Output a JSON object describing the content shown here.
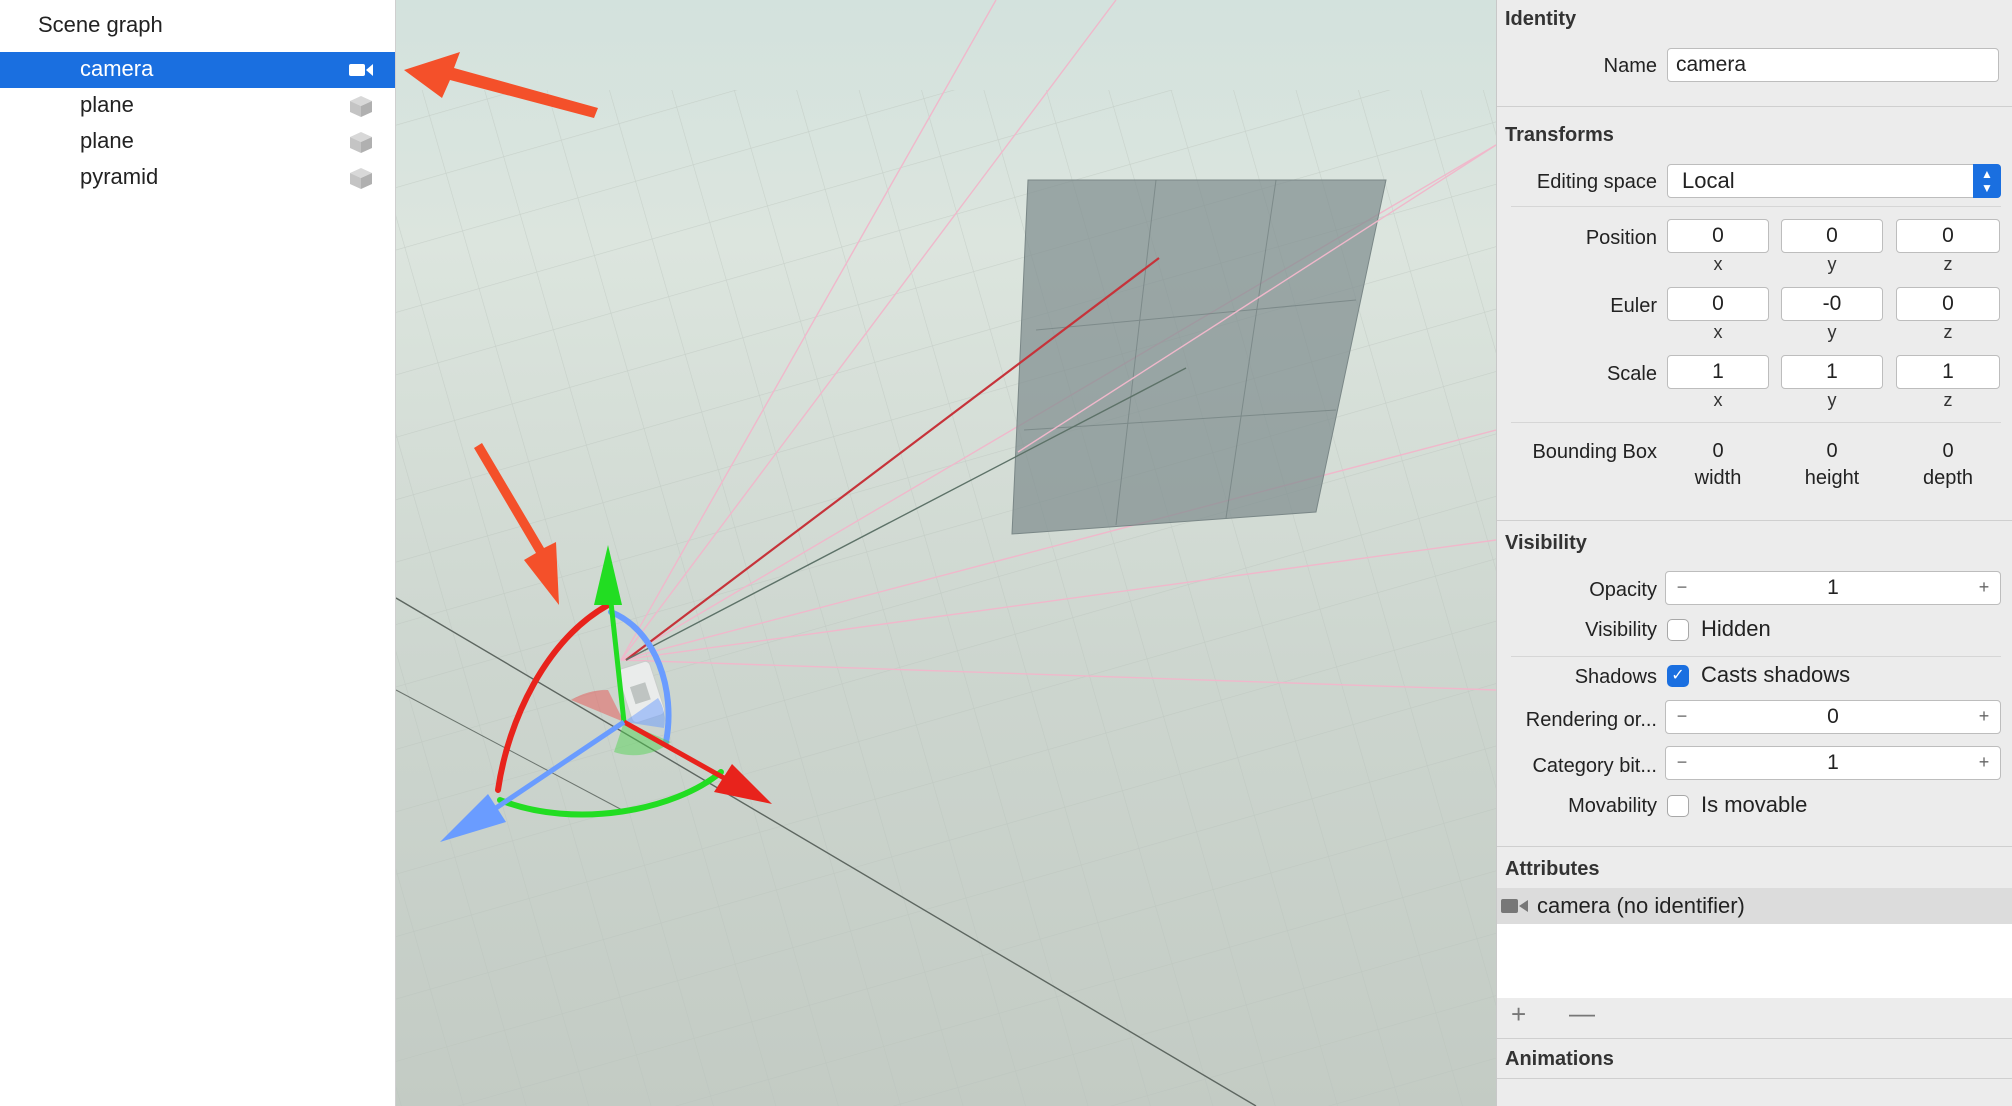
{
  "scene_graph": {
    "title": "Scene graph",
    "items": [
      {
        "label": "camera",
        "icon": "video-camera-icon",
        "selected": true
      },
      {
        "label": "plane",
        "icon": "cube-icon",
        "selected": false
      },
      {
        "label": "plane",
        "icon": "cube-icon",
        "selected": false
      },
      {
        "label": "pyramid",
        "icon": "cube-icon",
        "selected": false
      }
    ]
  },
  "inspector": {
    "identity": {
      "title": "Identity",
      "name_label": "Name",
      "name_value": "camera"
    },
    "transforms": {
      "title": "Transforms",
      "editing_space_label": "Editing space",
      "editing_space_value": "Local",
      "position": {
        "label": "Position",
        "x": "0",
        "y": "0",
        "z": "0"
      },
      "euler": {
        "label": "Euler",
        "x": "0",
        "y": "-0",
        "z": "0"
      },
      "scale": {
        "label": "Scale",
        "x": "1",
        "y": "1",
        "z": "1"
      },
      "axis_labels": {
        "x": "x",
        "y": "y",
        "z": "z"
      },
      "bounding_box": {
        "label": "Bounding Box",
        "width": "0",
        "height": "0",
        "depth": "0",
        "width_label": "width",
        "height_label": "height",
        "depth_label": "depth"
      }
    },
    "visibility": {
      "title": "Visibility",
      "opacity_label": "Opacity",
      "opacity_value": "1",
      "visibility_label": "Visibility",
      "hidden_label": "Hidden",
      "hidden_checked": false,
      "shadows_label": "Shadows",
      "casts_shadows_label": "Casts shadows",
      "casts_shadows_checked": true,
      "rendering_order_label": "Rendering or...",
      "rendering_order_value": "0",
      "category_bit_label": "Category bit...",
      "category_bit_value": "1",
      "movability_label": "Movability",
      "is_movable_label": "Is movable",
      "is_movable_checked": false,
      "minus": "−",
      "plus": "+"
    },
    "attributes": {
      "title": "Attributes",
      "item_label": "camera (no identifier)",
      "add": "+",
      "remove": "—"
    },
    "animations": {
      "title": "Animations"
    }
  },
  "colors": {
    "selection": "#1a6fe0",
    "annotation_arrow": "#f4502a",
    "gizmo_x": "#e8231c",
    "gizmo_y": "#22dd22",
    "gizmo_z": "#6a9cff"
  },
  "checkmark": "✓"
}
